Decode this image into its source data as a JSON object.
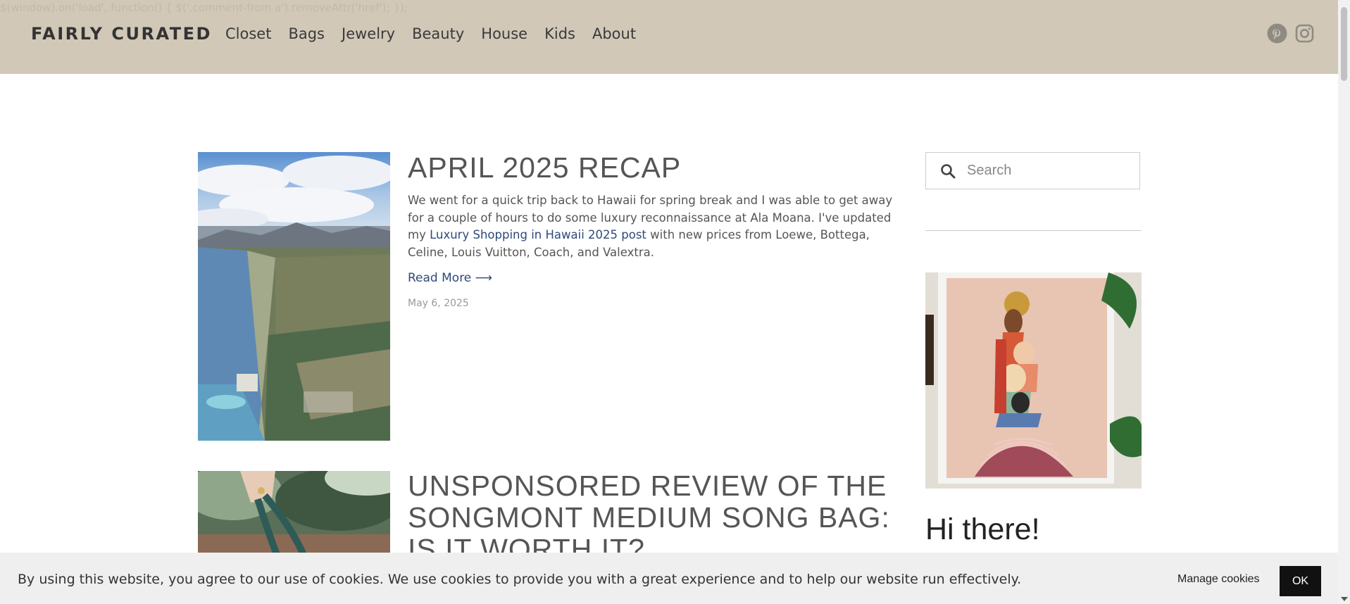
{
  "debug_script_text": "$(window).on('load', function() { $('.comment-from a').removeAttr('href'); });",
  "header": {
    "logo": "FAIRLY CURATED",
    "nav": [
      "Closet",
      "Bags",
      "Jewelry",
      "Beauty",
      "House",
      "Kids",
      "About"
    ],
    "social_icons": [
      "pinterest-icon",
      "instagram-icon"
    ]
  },
  "posts": [
    {
      "title": "APRIL 2025 RECAP",
      "excerpt_before_link": "We went for a quick trip back to Hawaii for spring break and I was able to get away for a couple of hours to do some luxury reconnaissance at Ala Moana.  I've updated my ",
      "excerpt_link": "Luxury Shopping in Hawaii 2025 post",
      "excerpt_after_link": " with new prices from Loewe, Bottega, Celine, Louis Vuitton, Coach, and Valextra.",
      "read_more": "Read More ⟶",
      "date": "May 6, 2025",
      "image": "aerial-coastline-photo"
    },
    {
      "title": "UNSPONSORED REVIEW OF THE SONGMONT MEDIUM SONG BAG: IS IT WORTH IT?",
      "image": "hand-holding-bag-photo"
    }
  ],
  "sidebar": {
    "search_placeholder": "Search",
    "greeting": "Hi there!",
    "image": "framed-illustration-women-art"
  },
  "cookie_banner": {
    "text": "By using this website, you agree to our use of cookies. We use cookies to provide you with a great experience and to help our website run effectively.",
    "manage_label": "Manage cookies",
    "ok_label": "OK"
  },
  "colors": {
    "header_bg": "#d1c8b8",
    "link": "#2e4a7a",
    "cookie_bg": "#efefef",
    "ok_button_bg": "#111111"
  }
}
